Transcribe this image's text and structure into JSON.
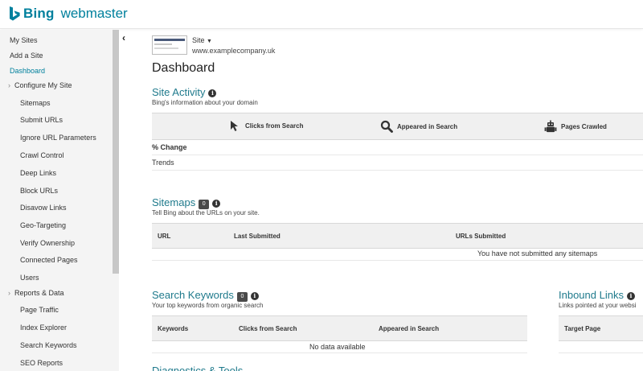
{
  "header": {
    "brand_name": "Bing",
    "product_name": "webmaster",
    "brand_color": "#00809d"
  },
  "sidebar": {
    "collapse_icon": "chevron-left-icon",
    "items": [
      {
        "label": "My Sites",
        "level": 0
      },
      {
        "label": "Add a Site",
        "level": 0
      },
      {
        "label": "Dashboard",
        "level": 0,
        "active": true
      },
      {
        "label": "Configure My Site",
        "level": 0,
        "expander": true
      },
      {
        "label": "Sitemaps",
        "level": 1
      },
      {
        "label": "Submit URLs",
        "level": 1
      },
      {
        "label": "Ignore URL Parameters",
        "level": 1
      },
      {
        "label": "Crawl Control",
        "level": 1
      },
      {
        "label": "Deep Links",
        "level": 1
      },
      {
        "label": "Block URLs",
        "level": 1
      },
      {
        "label": "Disavow Links",
        "level": 1
      },
      {
        "label": "Geo-Targeting",
        "level": 1
      },
      {
        "label": "Verify Ownership",
        "level": 1
      },
      {
        "label": "Connected Pages",
        "level": 1
      },
      {
        "label": "Users",
        "level": 1
      },
      {
        "label": "Reports & Data",
        "level": 0,
        "expander": true
      },
      {
        "label": "Page Traffic",
        "level": 1
      },
      {
        "label": "Index Explorer",
        "level": 1
      },
      {
        "label": "Search Keywords",
        "level": 1
      },
      {
        "label": "SEO Reports",
        "level": 1
      }
    ]
  },
  "site": {
    "selector_label": "Site",
    "url": "www.examplecompany.uk"
  },
  "page": {
    "title": "Dashboard"
  },
  "site_activity": {
    "title": "Site Activity",
    "subtitle": "Bing's information about your domain",
    "columns": [
      {
        "label": "Clicks from Search",
        "icon": "cursor-icon"
      },
      {
        "label": "Appeared in Search",
        "icon": "magnifier-icon"
      },
      {
        "label": "Pages Crawled",
        "icon": "robot-icon"
      }
    ],
    "rows": [
      "% Change",
      "Trends"
    ]
  },
  "sitemaps": {
    "title": "Sitemaps",
    "count": "0",
    "subtitle": "Tell Bing about the URLs on your site.",
    "columns": [
      "URL",
      "Last Submitted",
      "URLs Submitted"
    ],
    "empty_message": "You have not submitted any sitemaps"
  },
  "search_keywords": {
    "title": "Search Keywords",
    "count": "0",
    "subtitle": "Your top keywords from organic search",
    "columns": [
      "Keywords",
      "Clicks from Search",
      "Appeared in Search"
    ],
    "empty_message": "No data available"
  },
  "inbound_links": {
    "title": "Inbound Links",
    "subtitle": "Links pointed at your websi",
    "columns": [
      "Target Page"
    ]
  },
  "partial_title": "Diagnostics & Tools"
}
